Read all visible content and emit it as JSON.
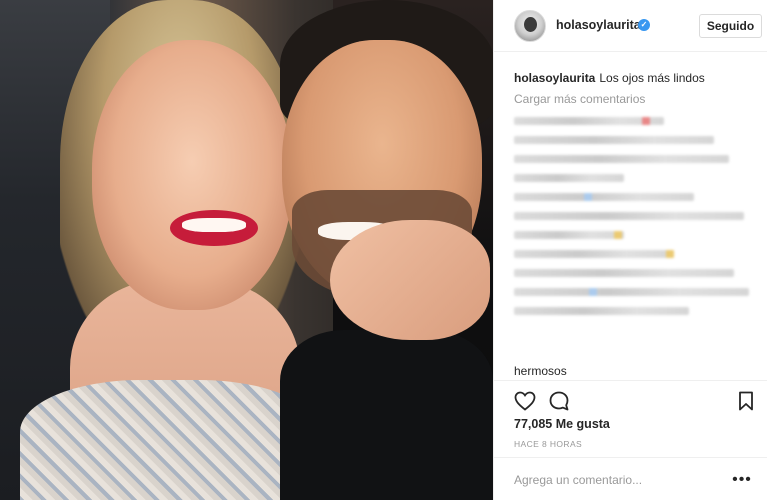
{
  "post": {
    "username": "holasoylaurita",
    "verified_icon": "verified-badge-icon",
    "follow_label": "Seguido",
    "caption_user": "holasoylaurita",
    "caption_text": "Los ojos más lindos",
    "load_more": "Cargar más comentarios",
    "last_visible_comment": "hermosos",
    "likes": "77,085 Me gusta",
    "time_ago": "HACE 8 HORAS",
    "add_comment_placeholder": "Agrega un comentario...",
    "more_label": "•••"
  },
  "colors": {
    "verified": "#3897f0",
    "accent_red": "#e57373",
    "accent_blue": "#9ec3ea",
    "accent_yellow": "#e8c15a",
    "muted_text": "#999999"
  },
  "icons": [
    "heart-icon",
    "comment-icon",
    "bookmark-icon",
    "more-options-icon"
  ]
}
